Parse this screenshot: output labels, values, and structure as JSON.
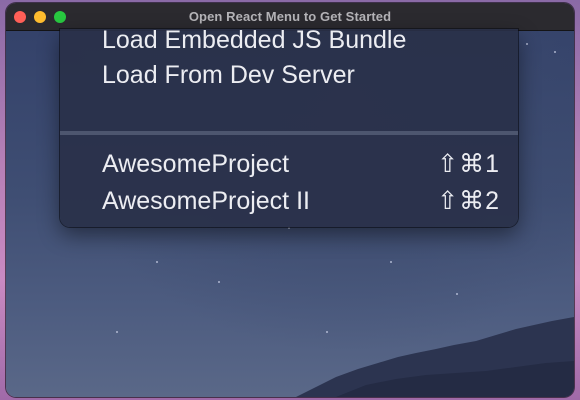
{
  "window": {
    "title": "Open React Menu to Get Started"
  },
  "menu": {
    "items": [
      {
        "label": "Load Embedded JS Bundle",
        "shortcut": ""
      },
      {
        "label": "Load From Dev Server",
        "shortcut": ""
      },
      {
        "label": "AwesomeProject",
        "shortcut": "⇧⌘1"
      },
      {
        "label": "AwesomeProject II",
        "shortcut": "⇧⌘2"
      }
    ]
  },
  "colors": {
    "titlebar": "#2b2a2f",
    "close": "#ff5f57",
    "minimize": "#febc2e",
    "maximize": "#28c840",
    "menu_background": "#293048",
    "menu_text": "#ecedf2"
  }
}
